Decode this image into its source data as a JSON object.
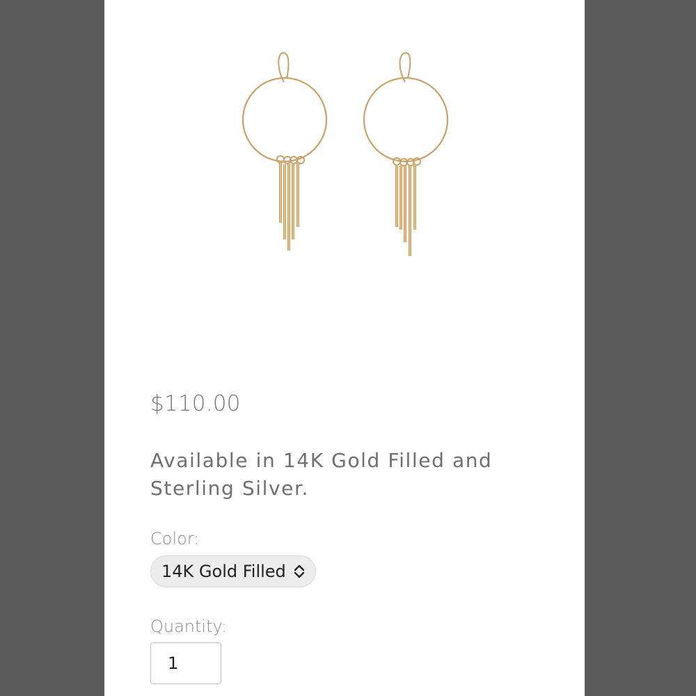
{
  "product": {
    "image_alt": "Gold hoop earrings with fringe bars",
    "price": "$110.00",
    "description": "Available in 14K Gold Filled and Sterling Silver."
  },
  "options": {
    "color_label": "Color:",
    "color_selected": "14K Gold Filled",
    "quantity_label": "Quantity:",
    "quantity_value": "1"
  },
  "colors": {
    "backdrop": "#5a5a5a",
    "page": "#ffffff",
    "gold": "#d4a05a",
    "text_muted": "#777777"
  }
}
